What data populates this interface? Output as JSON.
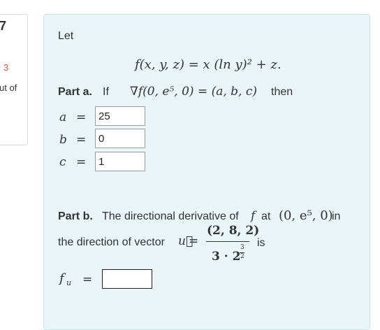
{
  "side_panel": {
    "number": "7",
    "score": "3",
    "out_of": "ut of"
  },
  "problem": {
    "intro": "Let",
    "function_def": "f(x, y, z) = x (ln y)² + z.",
    "part_a": {
      "label": "Part a.",
      "if_text": "If",
      "gradient_expr": "∇f(0, e⁵, 0) = (a, b, c)",
      "then_text": "then",
      "answers": [
        {
          "var": "a",
          "eq": "=",
          "value": "25"
        },
        {
          "var": "b",
          "eq": "=",
          "value": "0"
        },
        {
          "var": "c",
          "eq": "=",
          "value": "1"
        }
      ]
    },
    "part_b": {
      "label": "Part b.",
      "text1": "The directional derivative of",
      "f_symbol": "f",
      "at_text": "at",
      "point": "(0, e⁵, 0)",
      "in_text": "in",
      "text2": "the direction of vector",
      "u_vec": "u⃗",
      "eq": "=",
      "numerator": "(2, 8, 2)",
      "denominator": "3 · 2",
      "exp_num": "3",
      "exp_den": "2",
      "is_text": "is",
      "answer_var": "f",
      "answer_sub": "u",
      "answer_value": ""
    }
  }
}
